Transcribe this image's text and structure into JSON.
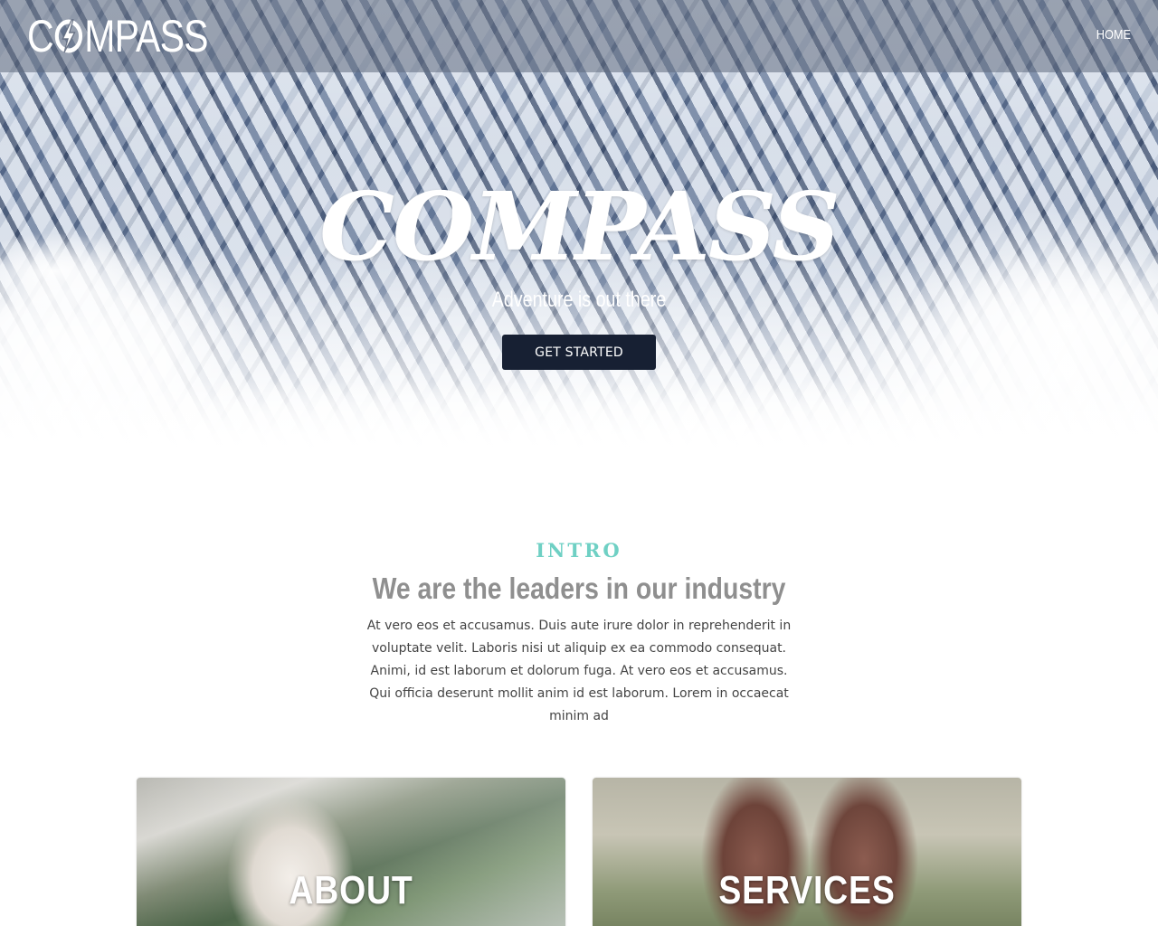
{
  "nav": {
    "logo_text_prefix": "C",
    "logo_text_suffix": "MPASS",
    "logo_icon": "compass-bolt-icon",
    "home_label": "HOME"
  },
  "hero": {
    "title": "COMPASS",
    "subtitle": "Adventure is out there",
    "cta_label": "GET STARTED"
  },
  "intro": {
    "label": "INTRO",
    "heading": "We are the leaders in our industry",
    "body": "At vero eos et accusamus. Duis aute irure dolor in reprehenderit in voluptate velit. Laboris nisi ut aliquip ex ea commodo consequat. Animi, id est laborum et dolorum fuga. At vero eos et accusamus. Qui officia deserunt mollit anim id est laborum. Lorem in occaecat minim ad"
  },
  "cards": [
    {
      "title": "ABOUT"
    },
    {
      "title": "SERVICES"
    }
  ],
  "colors": {
    "accent": "#6fd0c4",
    "button": "#172033",
    "heading_gray": "#8f8f8f"
  }
}
